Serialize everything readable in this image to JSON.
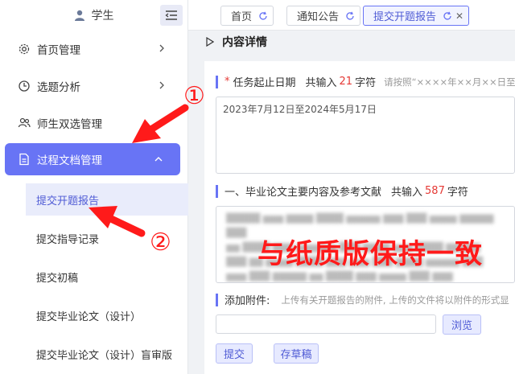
{
  "sidebar": {
    "user_name": "学生",
    "items": [
      {
        "label": "首页管理"
      },
      {
        "label": "选题分析"
      },
      {
        "label": "师生双选管理"
      },
      {
        "label": "过程文档管理"
      }
    ],
    "sub_items": [
      {
        "label": "提交开题报告"
      },
      {
        "label": "提交指导记录"
      },
      {
        "label": "提交初稿"
      },
      {
        "label": "提交毕业论文（设计）"
      },
      {
        "label": "提交毕业论文（设计）盲审版"
      }
    ]
  },
  "tabs": [
    {
      "label": "首页"
    },
    {
      "label": "通知公告"
    },
    {
      "label": "提交开题报告"
    }
  ],
  "section_title": "内容详情",
  "form": {
    "period": {
      "label": "任务起止日期",
      "count_prefix": "共输入",
      "count": "21",
      "count_suffix": "字符",
      "hint": "请按照“××××年××月××日至",
      "value": "2023年7月12日至2024年5月17日"
    },
    "content": {
      "label": "一、毕业论文主要内容及参考文献",
      "count_prefix": "共输入",
      "count": "587",
      "count_suffix": "字符",
      "overlay": "与纸质版保持一致"
    },
    "attachment": {
      "label": "添加附件:",
      "hint": "上传有关开题报告的附件, 上传的文件将以附件的形式显",
      "browse_label": "浏览"
    },
    "submit_label": "提交",
    "draft_label": "存草稿"
  },
  "annotations": {
    "one": "①",
    "two": "②"
  },
  "colors": {
    "accent": "#6874f5",
    "annotation": "#ff1a1a"
  }
}
